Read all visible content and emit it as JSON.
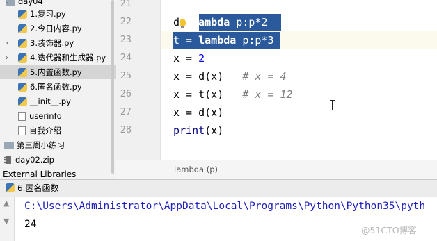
{
  "sidebar": {
    "top_folder": "day04",
    "items": [
      {
        "label": "1.复习.py"
      },
      {
        "label": "2.今日内容.py"
      },
      {
        "label": "3.装饰器.py"
      },
      {
        "label": "4.迭代器和生成器.py"
      },
      {
        "label": "5.内置函数.py"
      },
      {
        "label": "6.匿名函数.py"
      },
      {
        "label": "__init__.py"
      },
      {
        "label": "userinfo"
      },
      {
        "label": "自我介绍"
      },
      {
        "label": "第三周小练习"
      },
      {
        "label": "day02.zip"
      }
    ],
    "external_libraries": "External Libraries"
  },
  "editor": {
    "line_numbers": [
      "21",
      "22",
      "23",
      "24",
      "25",
      "26",
      "27",
      "28"
    ],
    "lines": [
      {
        "text": ""
      },
      {
        "parts": [
          "d",
          "= ",
          "lambda",
          " p:p*2"
        ]
      },
      {
        "parts": [
          "t = ",
          "lambda",
          " p:p*3"
        ]
      },
      {
        "parts": [
          "x = ",
          "2"
        ]
      },
      {
        "parts": [
          "x = d(x)",
          "   ",
          "# x = 4"
        ]
      },
      {
        "parts": [
          "x = t(x)",
          "   ",
          "# x = 12"
        ]
      },
      {
        "parts": [
          "x = d(x)"
        ]
      },
      {
        "parts": [
          "print",
          "(x)"
        ]
      }
    ],
    "breadcrumb": "lambda (p)"
  },
  "run_panel": {
    "tab_label": "6.匿名函数",
    "command": "C:\\Users\\Administrator\\AppData\\Local\\Programs\\Python\\Python35\\pyth",
    "output": "24"
  },
  "watermark": "@51CTO博客",
  "colors": {
    "selection": "#2b5a9c",
    "keyword": "#000080",
    "comment": "#808080",
    "console_command": "#2020c0",
    "sidebar_bg": "#f2f2f2",
    "selected_row": "#d5d5d5"
  }
}
